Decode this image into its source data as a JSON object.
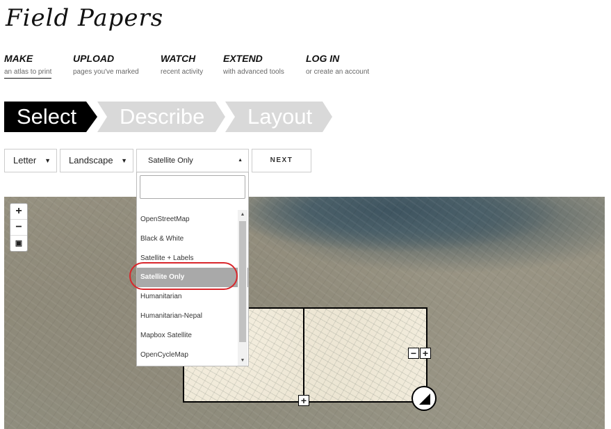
{
  "app": {
    "logo_text": "Field Papers"
  },
  "nav": [
    {
      "title": "MAKE",
      "sub": "an atlas to print"
    },
    {
      "title": "UPLOAD",
      "sub": "pages you've marked"
    },
    {
      "title": "WATCH",
      "sub": "recent activity"
    },
    {
      "title": "EXTEND",
      "sub": "with advanced tools"
    },
    {
      "title": "LOG IN",
      "sub": "or create an account"
    }
  ],
  "steps": [
    "Select",
    "Describe",
    "Layout"
  ],
  "form": {
    "paper_size": "Letter",
    "orientation": "Landscape",
    "map_style": "Satellite Only",
    "next_label": "NEXT",
    "search_value": ""
  },
  "dropdown": {
    "options": [
      "OpenStreetMap",
      "Black & White",
      "Satellite + Labels",
      "Satellite Only",
      "Humanitarian",
      "Humanitarian-Nepal",
      "Mapbox Satellite",
      "OpenCycleMap"
    ],
    "selected": "Satellite Only"
  },
  "map": {
    "zoom_in": "+",
    "zoom_out": "−",
    "select_tool": "▣",
    "page_remove": "−",
    "page_add": "+",
    "page_add_bottom": "+"
  },
  "colors": {
    "accent": "#000000",
    "highlight": "#d9262b"
  }
}
